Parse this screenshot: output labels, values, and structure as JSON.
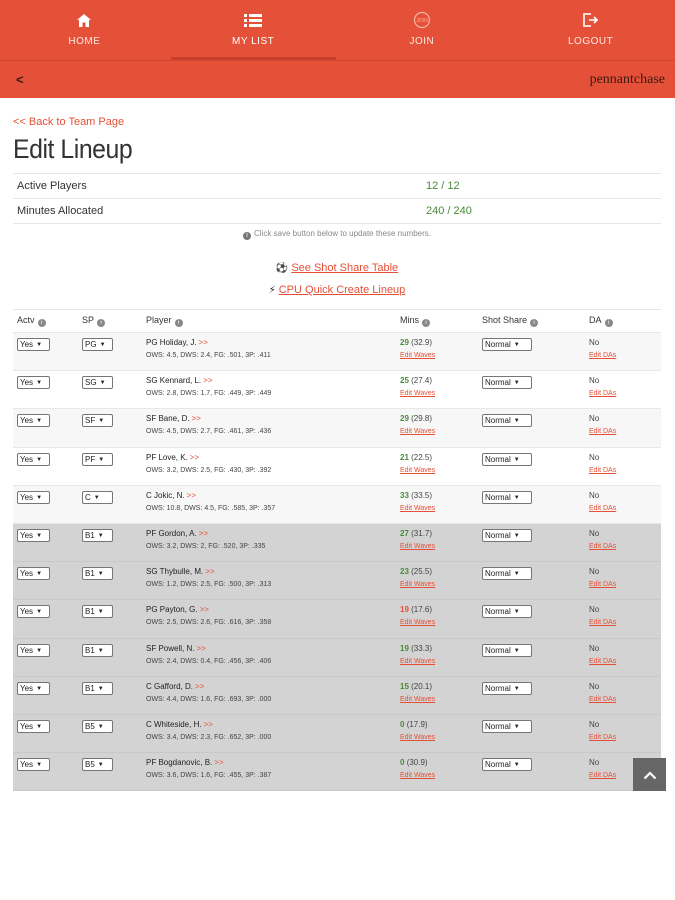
{
  "nav": {
    "items": [
      {
        "label": "HOME",
        "icon": "home-icon"
      },
      {
        "label": "MY LIST",
        "icon": "list-icon",
        "active": true
      },
      {
        "label": "JOIN",
        "icon": "join-icon"
      },
      {
        "label": "LOGOUT",
        "icon": "logout-icon"
      }
    ],
    "back": "<",
    "brand": "pennantchase",
    "accent": "#e55038"
  },
  "page": {
    "back_link": "<< Back to Team Page",
    "title": "Edit Lineup"
  },
  "summary": {
    "active_label": "Active Players",
    "active_value": "12 / 12",
    "minutes_label": "Minutes Allocated",
    "minutes_value": "240 / 240",
    "note": "Click save button below to update these numbers."
  },
  "links": {
    "shot_share": "See Shot Share Table",
    "cpu": "CPU Quick Create Lineup"
  },
  "table": {
    "headers": {
      "actv": "Actv",
      "sp": "SP",
      "player": "Player",
      "mins": "Mins",
      "shot": "Shot Share",
      "da": "DA"
    },
    "edit_waves": "Edit Waves",
    "edit_das": "Edit DAs",
    "rows": [
      {
        "actv": "Yes",
        "sp": "PG",
        "name": "PG Holiday, J.",
        "more": ">>",
        "stats": "OWS: 4.5, DWS: 2.4, FG: .501, 3P: .411",
        "mins": "29",
        "avg": "(32.9)",
        "shot": "Normal",
        "da": "No",
        "bench": false
      },
      {
        "actv": "Yes",
        "sp": "SG",
        "name": "SG Kennard, L.",
        "more": ">>",
        "stats": "OWS: 2.8, DWS: 1.7, FG: .449, 3P: .449",
        "mins": "25",
        "avg": "(27.4)",
        "shot": "Normal",
        "da": "No",
        "bench": false
      },
      {
        "actv": "Yes",
        "sp": "SF",
        "name": "SF Bane, D.",
        "more": ">>",
        "stats": "OWS: 4.5, DWS: 2.7, FG: .461, 3P: .436",
        "mins": "29",
        "avg": "(29.8)",
        "shot": "Normal",
        "da": "No",
        "bench": false
      },
      {
        "actv": "Yes",
        "sp": "PF",
        "name": "PF Love, K.",
        "more": ">>",
        "stats": "OWS: 3.2, DWS: 2.5, FG: .430, 3P: .392",
        "mins": "21",
        "avg": "(22.5)",
        "shot": "Normal",
        "da": "No",
        "bench": false
      },
      {
        "actv": "Yes",
        "sp": "C",
        "name": "C Jokic, N.",
        "more": ">>",
        "stats": "OWS: 10.8, DWS: 4.5, FG: .585, 3P: .357",
        "mins": "33",
        "avg": "(33.5)",
        "shot": "Normal",
        "da": "No",
        "bench": false
      },
      {
        "actv": "Yes",
        "sp": "B1",
        "name": "PF Gordon, A.",
        "more": ">>",
        "stats": "OWS: 3.2, DWS: 2, FG: .520, 3P: .335",
        "mins": "27",
        "avg": "(31.7)",
        "shot": "Normal",
        "da": "No",
        "bench": true
      },
      {
        "actv": "Yes",
        "sp": "B1",
        "name": "SG Thybulle, M.",
        "more": ">>",
        "stats": "OWS: 1.2, DWS: 2.5, FG: .500, 3P: .313",
        "mins": "23",
        "avg": "(25.5)",
        "shot": "Normal",
        "da": "No",
        "bench": true
      },
      {
        "actv": "Yes",
        "sp": "B1",
        "name": "PG Payton, G.",
        "more": ">>",
        "stats": "OWS: 2.5, DWS: 2.6, FG: .616, 3P: .358",
        "mins": "19",
        "avg": "(17.6)",
        "shot": "Normal",
        "da": "No",
        "bench": true,
        "low": true
      },
      {
        "actv": "Yes",
        "sp": "B1",
        "name": "SF Powell, N.",
        "more": ">>",
        "stats": "OWS: 2.4, DWS: 0.4, FG: .456, 3P: .406",
        "mins": "19",
        "avg": "(33.3)",
        "shot": "Normal",
        "da": "No",
        "bench": true
      },
      {
        "actv": "Yes",
        "sp": "B1",
        "name": "C Gafford, D.",
        "more": ">>",
        "stats": "OWS: 4.4, DWS: 1.6, FG: .693, 3P: .000",
        "mins": "15",
        "avg": "(20.1)",
        "shot": "Normal",
        "da": "No",
        "bench": true
      },
      {
        "actv": "Yes",
        "sp": "B5",
        "name": "C Whiteside, H.",
        "more": ">>",
        "stats": "OWS: 3.4, DWS: 2.3, FG: .652, 3P: .000",
        "mins": "0",
        "avg": "(17.9)",
        "shot": "Normal",
        "da": "No",
        "bench": true
      },
      {
        "actv": "Yes",
        "sp": "B5",
        "name": "PF Bogdanovic, B.",
        "more": ">>",
        "stats": "OWS: 3.6, DWS: 1.6, FG: .455, 3P: .387",
        "mins": "0",
        "avg": "(30.9)",
        "shot": "Normal",
        "da": "No",
        "bench": true
      }
    ]
  }
}
